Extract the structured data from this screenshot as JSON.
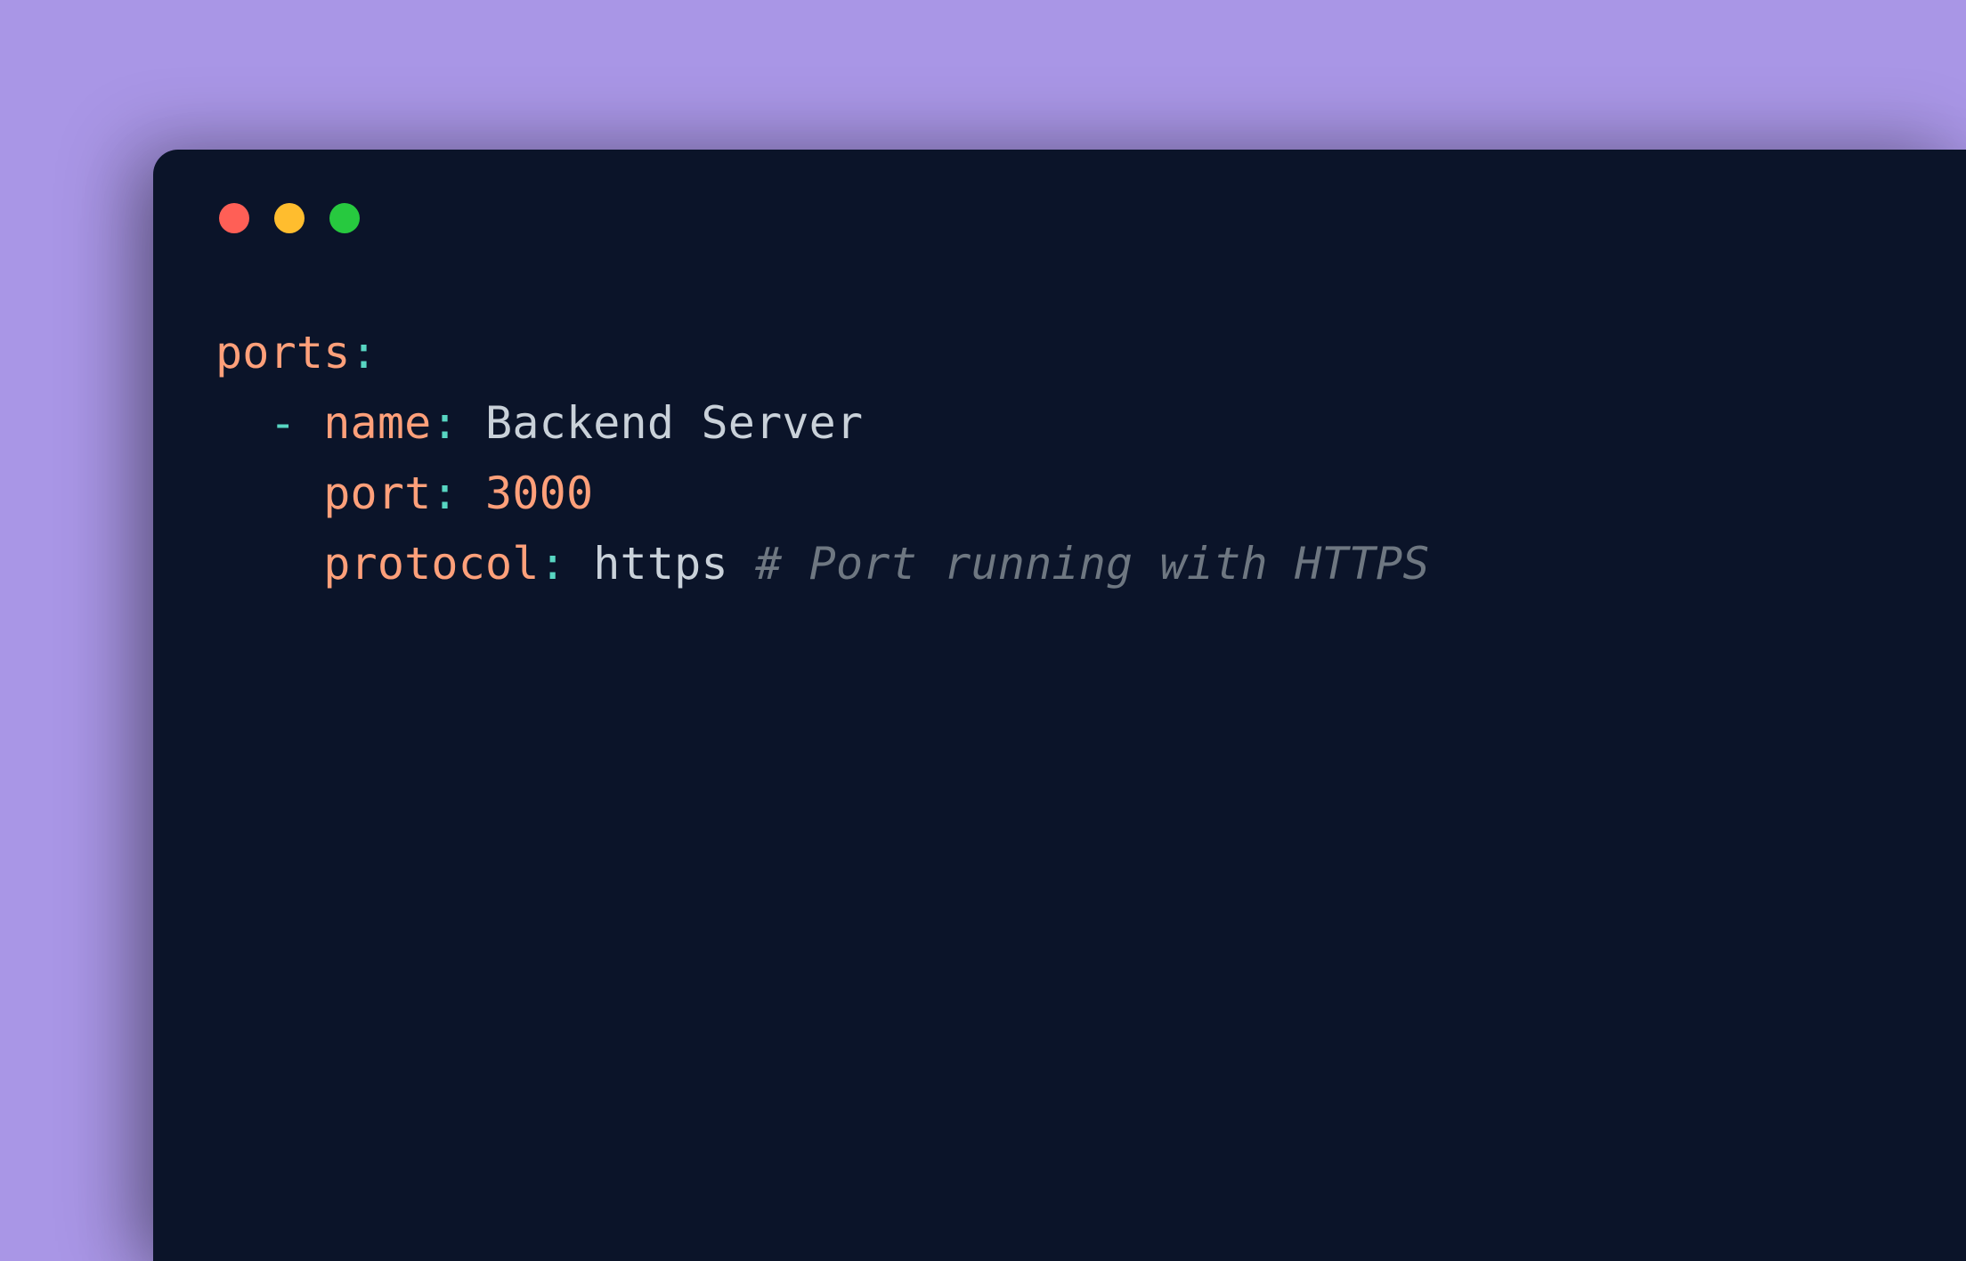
{
  "code": {
    "line1": {
      "key": "ports",
      "colon": ":"
    },
    "line2": {
      "indent": "  ",
      "dash": "- ",
      "key": "name",
      "colon": ": ",
      "value": "Backend Server"
    },
    "line3": {
      "indent": "    ",
      "key": "port",
      "colon": ": ",
      "value": "3000"
    },
    "line4": {
      "indent": "    ",
      "key": "protocol",
      "colon": ": ",
      "value": "https ",
      "comment": "# Port running with HTTPS"
    }
  },
  "colors": {
    "background": "#a996e6",
    "window": "#0b1429",
    "key": "#ffa07a",
    "punct": "#58d6c2",
    "string": "#c9d1d9",
    "number": "#ffa07a",
    "comment": "#6e7781",
    "traffic_red": "#ff5f56",
    "traffic_yellow": "#ffbd2e",
    "traffic_green": "#27c93f"
  }
}
